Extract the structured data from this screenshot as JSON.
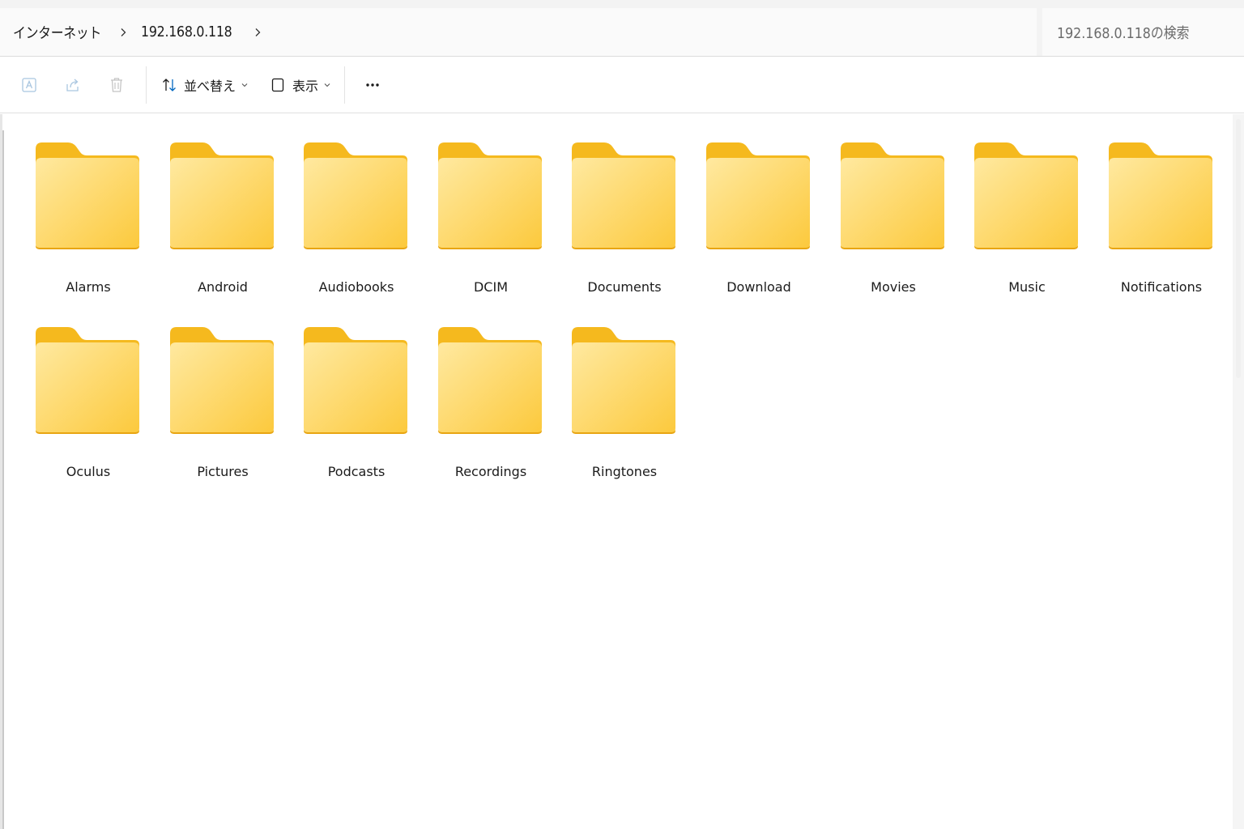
{
  "breadcrumb": {
    "items": [
      {
        "label": "インターネット"
      },
      {
        "label": "192.168.0.118"
      }
    ]
  },
  "search": {
    "placeholder": "192.168.0.118の検索"
  },
  "command_bar": {
    "sort_label": "並べ替え",
    "view_label": "表示",
    "icons": [
      "rename-icon",
      "share-icon",
      "delete-icon",
      "sort-icon",
      "view-icon",
      "more-icon"
    ]
  },
  "folders": [
    {
      "label": "Alarms"
    },
    {
      "label": "Android"
    },
    {
      "label": "Audiobooks"
    },
    {
      "label": "DCIM"
    },
    {
      "label": "Documents"
    },
    {
      "label": "Download"
    },
    {
      "label": "Movies"
    },
    {
      "label": "Music"
    },
    {
      "label": "Notifications"
    },
    {
      "label": "Oculus"
    },
    {
      "label": "Pictures"
    },
    {
      "label": "Podcasts"
    },
    {
      "label": "Recordings"
    },
    {
      "label": "Ringtones"
    }
  ],
  "colors": {
    "folder_tab": "#f5b91e",
    "folder_front_light": "#ffe9a0",
    "folder_front_dark": "#fcc93c",
    "accent": "#0067c0"
  }
}
